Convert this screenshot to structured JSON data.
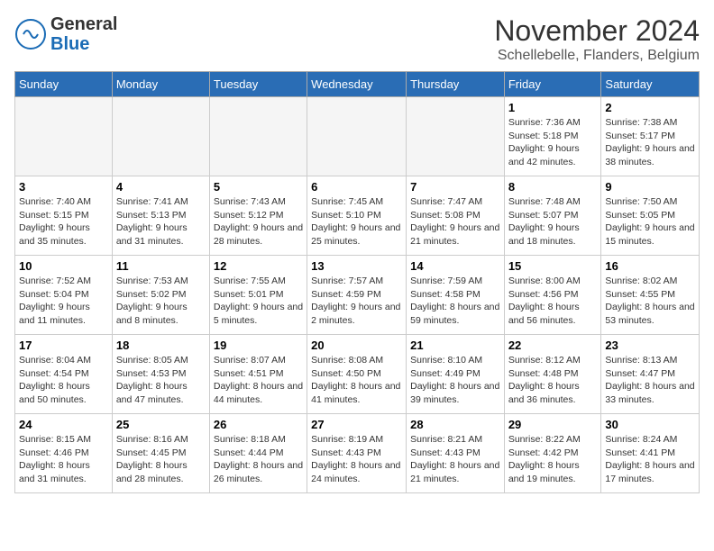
{
  "logo": {
    "general": "General",
    "blue": "Blue"
  },
  "header": {
    "title": "November 2024",
    "subtitle": "Schellebelle, Flanders, Belgium"
  },
  "days_of_week": [
    "Sunday",
    "Monday",
    "Tuesday",
    "Wednesday",
    "Thursday",
    "Friday",
    "Saturday"
  ],
  "weeks": [
    [
      {
        "day": "",
        "info": ""
      },
      {
        "day": "",
        "info": ""
      },
      {
        "day": "",
        "info": ""
      },
      {
        "day": "",
        "info": ""
      },
      {
        "day": "",
        "info": ""
      },
      {
        "day": "1",
        "info": "Sunrise: 7:36 AM\nSunset: 5:18 PM\nDaylight: 9 hours and 42 minutes."
      },
      {
        "day": "2",
        "info": "Sunrise: 7:38 AM\nSunset: 5:17 PM\nDaylight: 9 hours and 38 minutes."
      }
    ],
    [
      {
        "day": "3",
        "info": "Sunrise: 7:40 AM\nSunset: 5:15 PM\nDaylight: 9 hours and 35 minutes."
      },
      {
        "day": "4",
        "info": "Sunrise: 7:41 AM\nSunset: 5:13 PM\nDaylight: 9 hours and 31 minutes."
      },
      {
        "day": "5",
        "info": "Sunrise: 7:43 AM\nSunset: 5:12 PM\nDaylight: 9 hours and 28 minutes."
      },
      {
        "day": "6",
        "info": "Sunrise: 7:45 AM\nSunset: 5:10 PM\nDaylight: 9 hours and 25 minutes."
      },
      {
        "day": "7",
        "info": "Sunrise: 7:47 AM\nSunset: 5:08 PM\nDaylight: 9 hours and 21 minutes."
      },
      {
        "day": "8",
        "info": "Sunrise: 7:48 AM\nSunset: 5:07 PM\nDaylight: 9 hours and 18 minutes."
      },
      {
        "day": "9",
        "info": "Sunrise: 7:50 AM\nSunset: 5:05 PM\nDaylight: 9 hours and 15 minutes."
      }
    ],
    [
      {
        "day": "10",
        "info": "Sunrise: 7:52 AM\nSunset: 5:04 PM\nDaylight: 9 hours and 11 minutes."
      },
      {
        "day": "11",
        "info": "Sunrise: 7:53 AM\nSunset: 5:02 PM\nDaylight: 9 hours and 8 minutes."
      },
      {
        "day": "12",
        "info": "Sunrise: 7:55 AM\nSunset: 5:01 PM\nDaylight: 9 hours and 5 minutes."
      },
      {
        "day": "13",
        "info": "Sunrise: 7:57 AM\nSunset: 4:59 PM\nDaylight: 9 hours and 2 minutes."
      },
      {
        "day": "14",
        "info": "Sunrise: 7:59 AM\nSunset: 4:58 PM\nDaylight: 8 hours and 59 minutes."
      },
      {
        "day": "15",
        "info": "Sunrise: 8:00 AM\nSunset: 4:56 PM\nDaylight: 8 hours and 56 minutes."
      },
      {
        "day": "16",
        "info": "Sunrise: 8:02 AM\nSunset: 4:55 PM\nDaylight: 8 hours and 53 minutes."
      }
    ],
    [
      {
        "day": "17",
        "info": "Sunrise: 8:04 AM\nSunset: 4:54 PM\nDaylight: 8 hours and 50 minutes."
      },
      {
        "day": "18",
        "info": "Sunrise: 8:05 AM\nSunset: 4:53 PM\nDaylight: 8 hours and 47 minutes."
      },
      {
        "day": "19",
        "info": "Sunrise: 8:07 AM\nSunset: 4:51 PM\nDaylight: 8 hours and 44 minutes."
      },
      {
        "day": "20",
        "info": "Sunrise: 8:08 AM\nSunset: 4:50 PM\nDaylight: 8 hours and 41 minutes."
      },
      {
        "day": "21",
        "info": "Sunrise: 8:10 AM\nSunset: 4:49 PM\nDaylight: 8 hours and 39 minutes."
      },
      {
        "day": "22",
        "info": "Sunrise: 8:12 AM\nSunset: 4:48 PM\nDaylight: 8 hours and 36 minutes."
      },
      {
        "day": "23",
        "info": "Sunrise: 8:13 AM\nSunset: 4:47 PM\nDaylight: 8 hours and 33 minutes."
      }
    ],
    [
      {
        "day": "24",
        "info": "Sunrise: 8:15 AM\nSunset: 4:46 PM\nDaylight: 8 hours and 31 minutes."
      },
      {
        "day": "25",
        "info": "Sunrise: 8:16 AM\nSunset: 4:45 PM\nDaylight: 8 hours and 28 minutes."
      },
      {
        "day": "26",
        "info": "Sunrise: 8:18 AM\nSunset: 4:44 PM\nDaylight: 8 hours and 26 minutes."
      },
      {
        "day": "27",
        "info": "Sunrise: 8:19 AM\nSunset: 4:43 PM\nDaylight: 8 hours and 24 minutes."
      },
      {
        "day": "28",
        "info": "Sunrise: 8:21 AM\nSunset: 4:43 PM\nDaylight: 8 hours and 21 minutes."
      },
      {
        "day": "29",
        "info": "Sunrise: 8:22 AM\nSunset: 4:42 PM\nDaylight: 8 hours and 19 minutes."
      },
      {
        "day": "30",
        "info": "Sunrise: 8:24 AM\nSunset: 4:41 PM\nDaylight: 8 hours and 17 minutes."
      }
    ]
  ]
}
